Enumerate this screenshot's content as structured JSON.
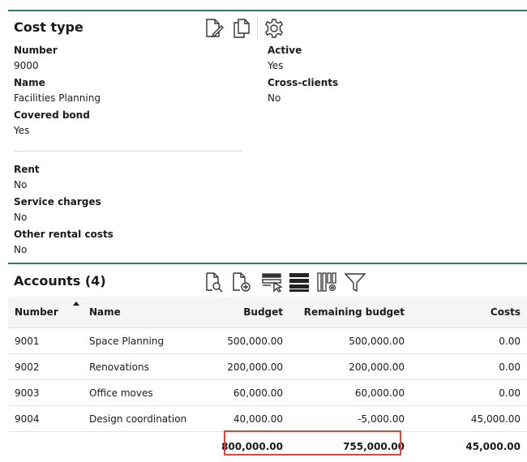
{
  "cost_type": {
    "title": "Cost type",
    "toolbar_icons": [
      "edit-document-icon",
      "copy-document-icon",
      "gear-icon"
    ],
    "fields_left": [
      {
        "label": "Number",
        "value": "9000"
      },
      {
        "label": "Name",
        "value": "Facilities Planning"
      },
      {
        "label": "Covered bond",
        "value": "Yes"
      }
    ],
    "fields_right": [
      {
        "label": "Active",
        "value": "Yes"
      },
      {
        "label": "Cross-clients",
        "value": "No"
      }
    ],
    "fields_extra": [
      {
        "label": "Rent",
        "value": "No"
      },
      {
        "label": "Service charges",
        "value": "No"
      },
      {
        "label": "Other rental costs",
        "value": "No"
      }
    ]
  },
  "accounts": {
    "title": "Accounts (4)",
    "toolbar_icons": [
      "search-document-icon",
      "add-document-icon",
      "highlight-rows-icon",
      "rows-icon",
      "columns-settings-icon",
      "filter-icon"
    ],
    "columns": [
      "Number",
      "Name",
      "Budget",
      "Remaining budget",
      "Costs"
    ],
    "rows": [
      {
        "number": "9001",
        "name": "Space Planning",
        "budget": "500,000.00",
        "remaining": "500,000.00",
        "costs": "0.00"
      },
      {
        "number": "9002",
        "name": "Renovations",
        "budget": "200,000.00",
        "remaining": "200,000.00",
        "costs": "0.00"
      },
      {
        "number": "9003",
        "name": "Office moves",
        "budget": "60,000.00",
        "remaining": "60,000.00",
        "costs": "0.00"
      },
      {
        "number": "9004",
        "name": "Design coordination",
        "budget": "40,000.00",
        "remaining": "-5,000.00",
        "costs": "45,000.00"
      }
    ],
    "totals": {
      "budget": "800,000.00",
      "remaining": "755,000.00",
      "costs": "45,000.00"
    }
  }
}
